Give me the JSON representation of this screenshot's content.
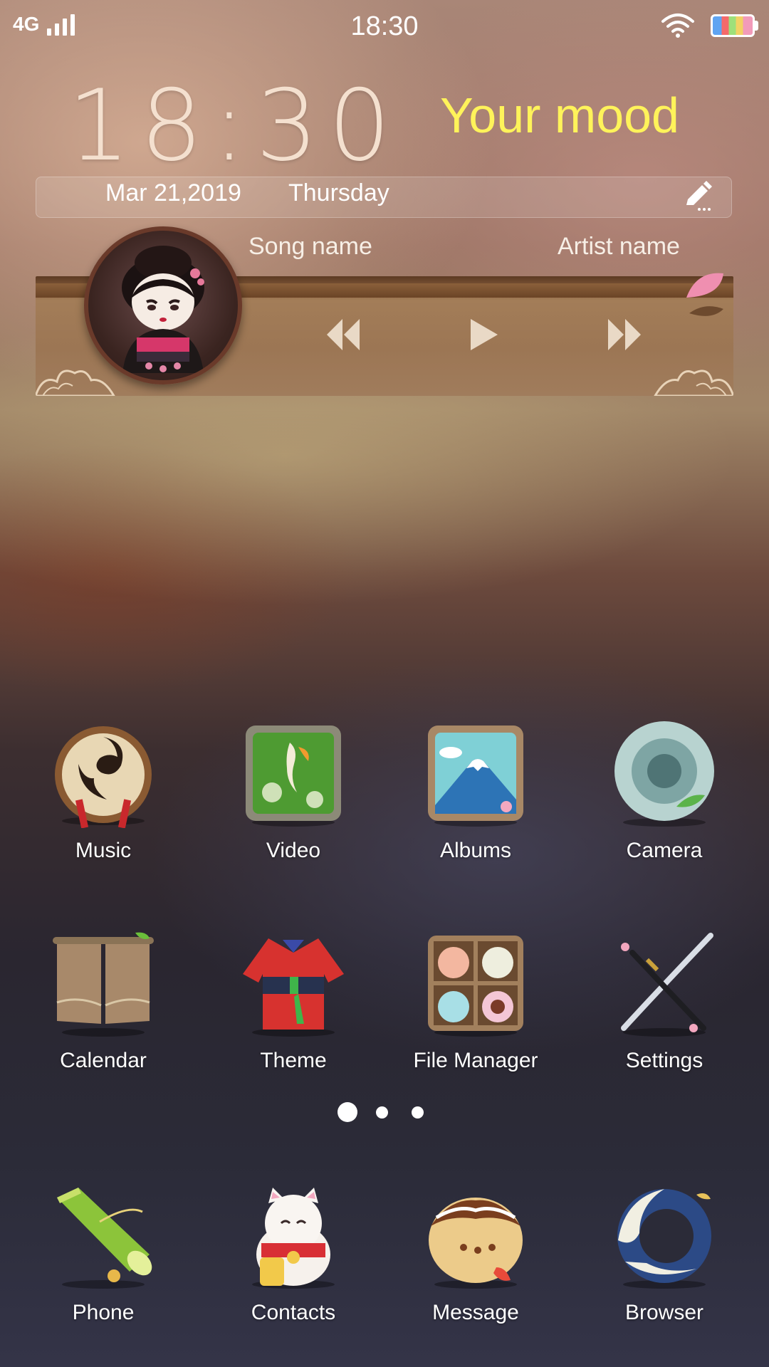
{
  "status_bar": {
    "network": "4G",
    "time": "18:30"
  },
  "clock_widget": {
    "time": "18:30",
    "mood": "Your mood",
    "date": "Mar 21,2019",
    "weekday": "Thursday"
  },
  "music_widget": {
    "song": "Song name",
    "artist": "Artist name"
  },
  "apps": [
    {
      "label": "Music",
      "icon": "taiko-drum-icon"
    },
    {
      "label": "Video",
      "icon": "koi-pond-icon"
    },
    {
      "label": "Albums",
      "icon": "mount-fuji-frame-icon"
    },
    {
      "label": "Camera",
      "icon": "celadon-bowl-icon"
    },
    {
      "label": "Calendar",
      "icon": "noren-curtain-icon"
    },
    {
      "label": "Theme",
      "icon": "kimono-icon"
    },
    {
      "label": "File Manager",
      "icon": "mochi-box-icon"
    },
    {
      "label": "Settings",
      "icon": "katana-icon"
    }
  ],
  "dock": [
    {
      "label": "Phone",
      "icon": "bamboo-icon"
    },
    {
      "label": "Contacts",
      "icon": "maneki-neko-icon"
    },
    {
      "label": "Message",
      "icon": "takoyaki-icon"
    },
    {
      "label": "Browser",
      "icon": "great-wave-icon"
    }
  ],
  "pager": {
    "pages": 3,
    "current": 1
  }
}
